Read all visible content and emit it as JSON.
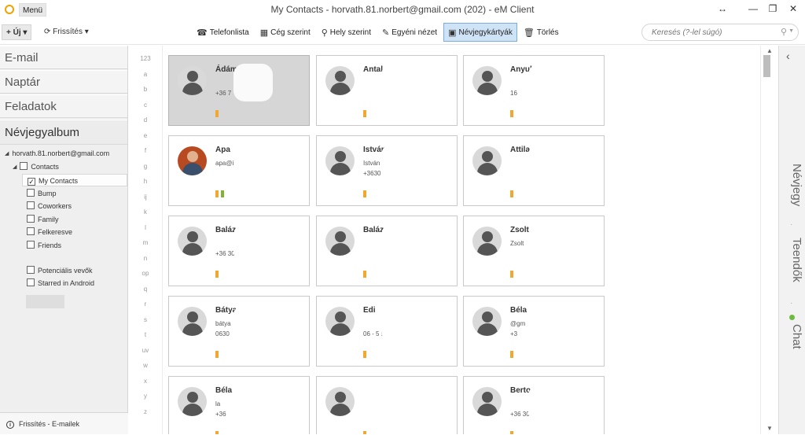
{
  "window": {
    "menu_label": "Menü",
    "title": "My Contacts - horvath.81.norbert@gmail.com (202) - eM Client",
    "controls": [
      "↔",
      "—",
      "❐",
      "✕"
    ]
  },
  "toolbar": {
    "new_label": "+ Új ▾",
    "refresh_label": "Frissítés ▾",
    "views": [
      {
        "icon": "☎",
        "label": "Telefonlista"
      },
      {
        "icon": "▦",
        "label": "Cég szerint"
      },
      {
        "icon": "⚲",
        "label": "Hely szerint"
      },
      {
        "icon": "✎",
        "label": "Egyéni nézet"
      },
      {
        "icon": "▣",
        "label": "Névjegykártyák",
        "active": true
      },
      {
        "icon": "🗑",
        "label": "Törlés"
      }
    ],
    "search_placeholder": "Keresés (?-lel súgó)"
  },
  "sidebar": {
    "nav": [
      "E-mail",
      "Naptár",
      "Feladatok",
      "Névjegyalbum"
    ],
    "account": "horvath.81.norbert@gmail.com",
    "root_folder": "Contacts",
    "folders": [
      {
        "label": "My Contacts",
        "checked": true,
        "selected": true
      },
      {
        "label": "Bump",
        "checked": false
      },
      {
        "label": "Coworkers",
        "checked": false
      },
      {
        "label": "Family",
        "checked": false
      },
      {
        "label": "Felkeresve",
        "checked": false
      },
      {
        "label": "Friends",
        "checked": false
      },
      {
        "label": "Potenciális vevők",
        "checked": false
      },
      {
        "label": "Starred in Android",
        "checked": false
      }
    ],
    "status": "Frissítés - E-mailek"
  },
  "alphabet": [
    "123",
    "a",
    "b",
    "c",
    "d",
    "e",
    "f",
    "g",
    "h",
    "ij",
    "k",
    "l",
    "m",
    "n",
    "op",
    "q",
    "r",
    "s",
    "t",
    "uv",
    "w",
    "x",
    "y",
    "z"
  ],
  "cards": [
    {
      "name": "Ádám",
      "lines": [
        "",
        "+36 7"
      ],
      "selected": true,
      "photo": false,
      "tags": 1
    },
    {
      "name": "Antal",
      "lines": [
        "",
        ""
      ],
      "photo": false,
      "tags": 1
    },
    {
      "name": "Anyuka",
      "lines": [
        "",
        "16"
      ],
      "photo": false,
      "tags": 1
    },
    {
      "name": "Apa",
      "lines": [
        "apa@icl.io",
        ""
      ],
      "photo": true,
      "tags": 2
    },
    {
      "name": "István",
      "lines": [
        "István",
        "+3630"
      ],
      "photo": false,
      "tags": 1
    },
    {
      "name": "Attila",
      "lines": [
        "",
        ""
      ],
      "photo": false,
      "tags": 1
    },
    {
      "name": "Balázs",
      "lines": [
        "",
        "+36 30"
      ],
      "photo": false,
      "tags": 1
    },
    {
      "name": "Balázs",
      "lines": [
        "",
        ""
      ],
      "photo": false,
      "tags": 1
    },
    {
      "name": "Zsolt",
      "lines": [
        "Zsolt",
        ""
      ],
      "photo": false,
      "tags": 1
    },
    {
      "name": "Bátya",
      "lines": [
        "bátya",
        "0630"
      ],
      "photo": false,
      "tags": 1
    },
    {
      "name": "Edi",
      "lines": [
        "",
        "06 - 5 9"
      ],
      "photo": false,
      "tags": 1
    },
    {
      "name": "Béla",
      "lines": [
        "@gm",
        "+3"
      ],
      "photo": false,
      "tags": 1
    },
    {
      "name": "Béla",
      "lines": [
        "la",
        "+36"
      ],
      "photo": false,
      "tags": 1
    },
    {
      "name": "",
      "lines": [
        "",
        ""
      ],
      "photo": false,
      "tags": 1
    },
    {
      "name": "Berto",
      "lines": [
        "",
        "+36 30"
      ],
      "photo": false,
      "tags": 1
    }
  ],
  "rightbar": {
    "collapse_icon": "‹",
    "tabs": [
      "Névjegy",
      "Teendők",
      "Chat"
    ],
    "separator": "·"
  }
}
